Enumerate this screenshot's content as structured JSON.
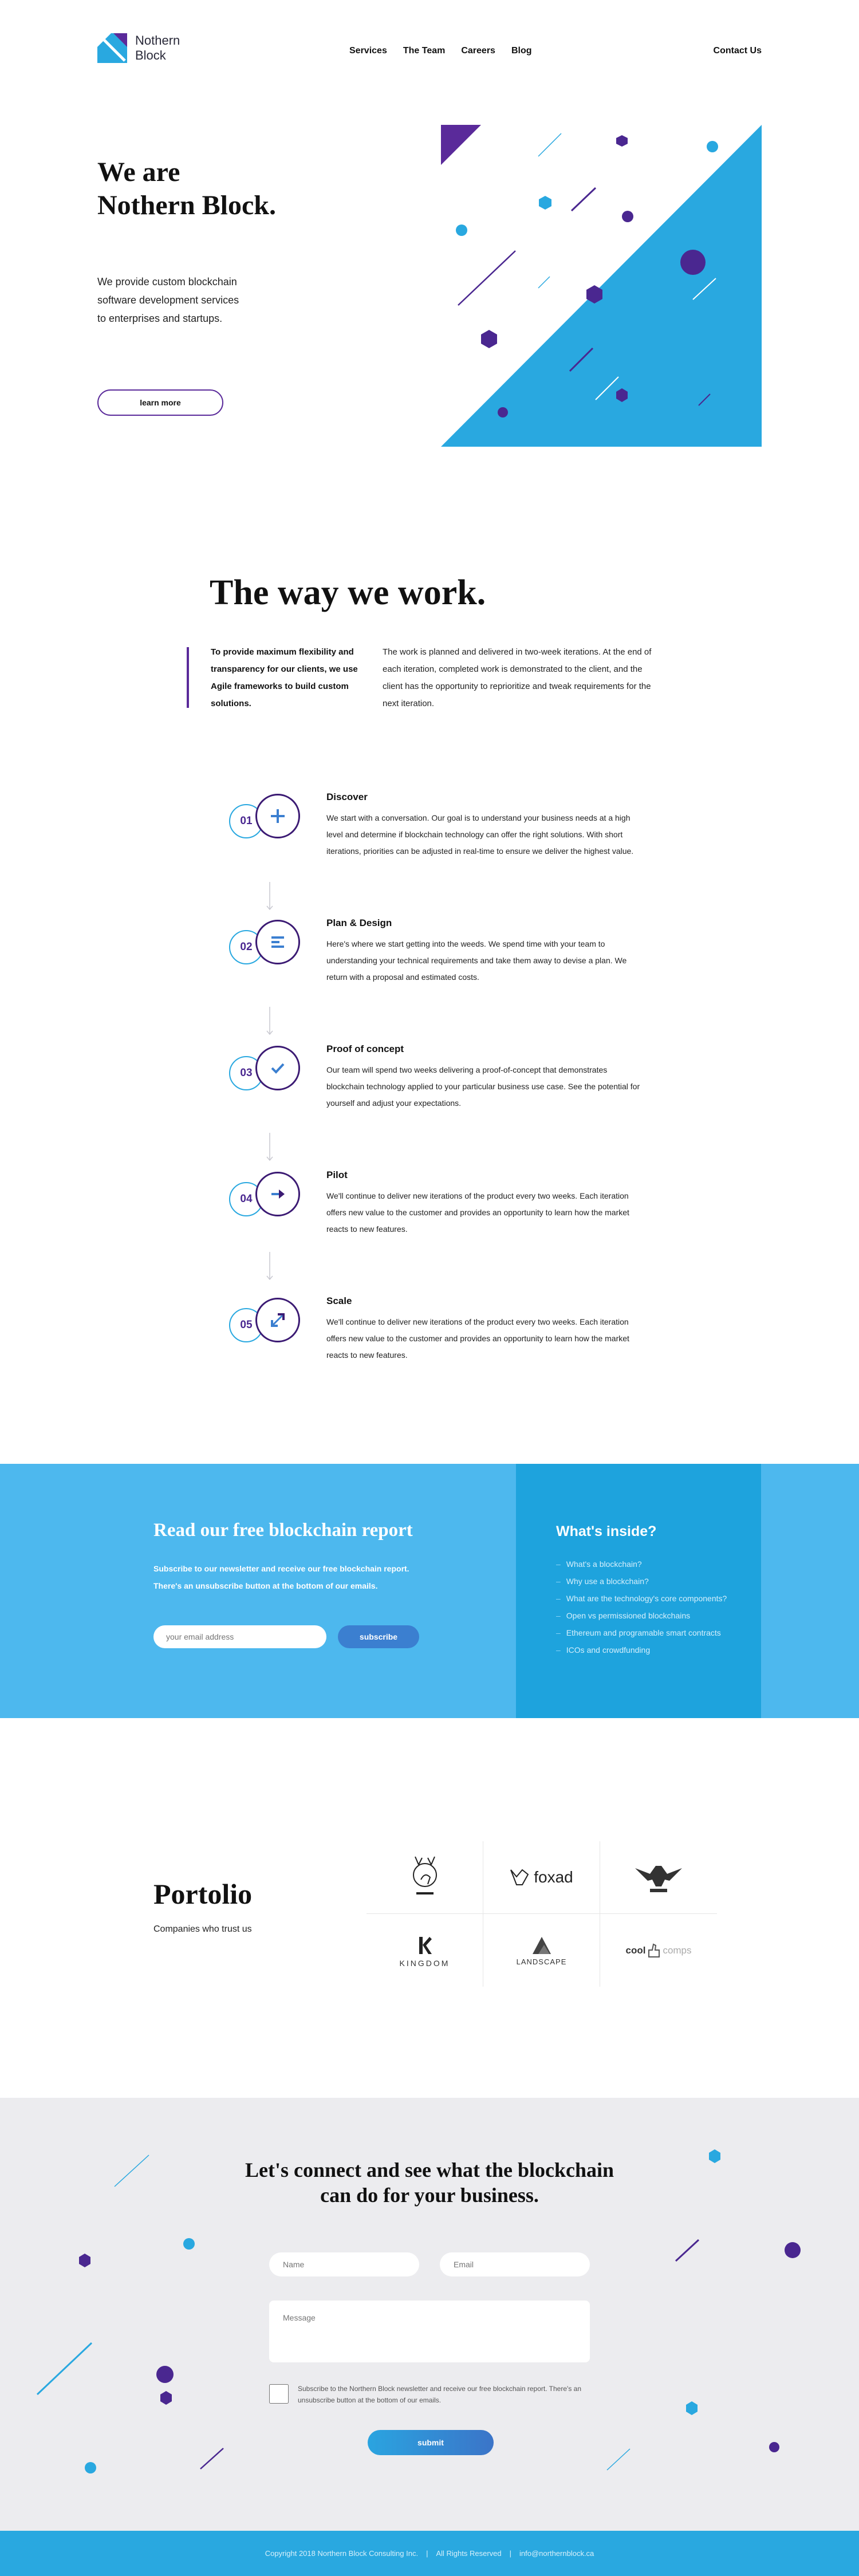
{
  "brand": {
    "name_line1": "Nothern",
    "name_line2": "Block",
    "colors": {
      "purple": "#5a2a9a",
      "deep_purple": "#3b1a73",
      "blue": "#29a8e0",
      "light_blue": "#4db8ee"
    }
  },
  "nav": {
    "items": [
      "Services",
      "The Team",
      "Careers",
      "Blog"
    ],
    "contact": "Contact Us"
  },
  "hero": {
    "title_line1": "We are",
    "title_line2": "Nothern Block.",
    "desc_line1": "We provide custom blockchain",
    "desc_line2": "software development services",
    "desc_line3": "to enterprises and startups.",
    "button": "learn more"
  },
  "way": {
    "title": "The way we work.",
    "lead": "To provide maximum flexibility and transparency for our clients, we use Agile frameworks to build custom solutions.",
    "body": "The work is planned and delivered in two-week iterations. At the end of each iteration, completed work is demonstrated to the client, and the client has the opportunity to reprioritize and tweak requirements for the next iteration.",
    "steps": [
      {
        "num": "01",
        "icon": "plus-icon",
        "title": "Discover",
        "desc": "We start with a conversation. Our goal is to understand your business needs at a high level and determine if blockchain technology can offer the right solutions. With short iterations, priorities can be adjusted in real-time to ensure we deliver the highest value."
      },
      {
        "num": "02",
        "icon": "list-icon",
        "title": "Plan & Design",
        "desc": "Here's where we start getting into the weeds. We spend time with your team to understanding your technical requirements and take them away to devise a plan. We return with a proposal and estimated costs."
      },
      {
        "num": "03",
        "icon": "check-icon",
        "title": "Proof of concept",
        "desc": "Our team will spend two weeks delivering a proof-of-concept that demonstrates blockchain technology applied to your particular business use case. See the potential for yourself and adjust your expectations."
      },
      {
        "num": "04",
        "icon": "arrow-right-icon",
        "title": "Pilot",
        "desc": "We'll continue to deliver new iterations of the product every two weeks. Each iteration offers new value to the customer and provides an  opportunity to learn how the market reacts to new features."
      },
      {
        "num": "05",
        "icon": "expand-icon",
        "title": "Scale",
        "desc": "We'll continue to deliver new iterations of the product every two weeks. Each iteration offers new value to the customer and provides an  opportunity to learn how the market reacts to new features."
      }
    ]
  },
  "report": {
    "title": "Read our free blockchain report",
    "note": "Subscribe to our newsletter and receive our free blockchain report. There's an unsubscribe button at the bottom of our emails.",
    "email_placeholder": "your email address",
    "button": "subscribe",
    "inside_title": "What's inside?",
    "inside_items": [
      "What's a blockchain?",
      "Why use a blockchain?",
      "What are the technology's core components?",
      "Open vs permissioned blockchains",
      "Ethereum and programable smart contracts",
      "ICOs and crowdfunding"
    ]
  },
  "portfolio": {
    "title": "Portolio",
    "subtitle": "Companies who trust us",
    "logos": [
      {
        "icon": "deer-logo-icon",
        "label": ""
      },
      {
        "icon": "foxad-logo-icon",
        "label": "foxad"
      },
      {
        "icon": "eagle-logo-icon",
        "label": ""
      },
      {
        "icon": "kingdom-logo-icon",
        "label": "KINGDOM"
      },
      {
        "icon": "landscape-logo-icon",
        "label": "LANDSCAPE"
      },
      {
        "icon": "coolcomps-logo-icon",
        "label_a": "cool",
        "label_b": "comps"
      }
    ]
  },
  "contact": {
    "title_line1": "Let's connect and see what the blockchain",
    "title_line2": "can do for your business.",
    "name_placeholder": "Name",
    "email_placeholder": "Email",
    "message_placeholder": "Message",
    "consent": "Subscribe to the Northern Block newsletter and receive our free blockchain report. There's an unsubscribe button at the bottom of our emails.",
    "button": "submit"
  },
  "footer": {
    "copyright": "Copyright 2018 Northern Block Consulting Inc.",
    "rights": "All Rights Reserved",
    "email": "info@northernblock.ca",
    "separator": "|"
  }
}
